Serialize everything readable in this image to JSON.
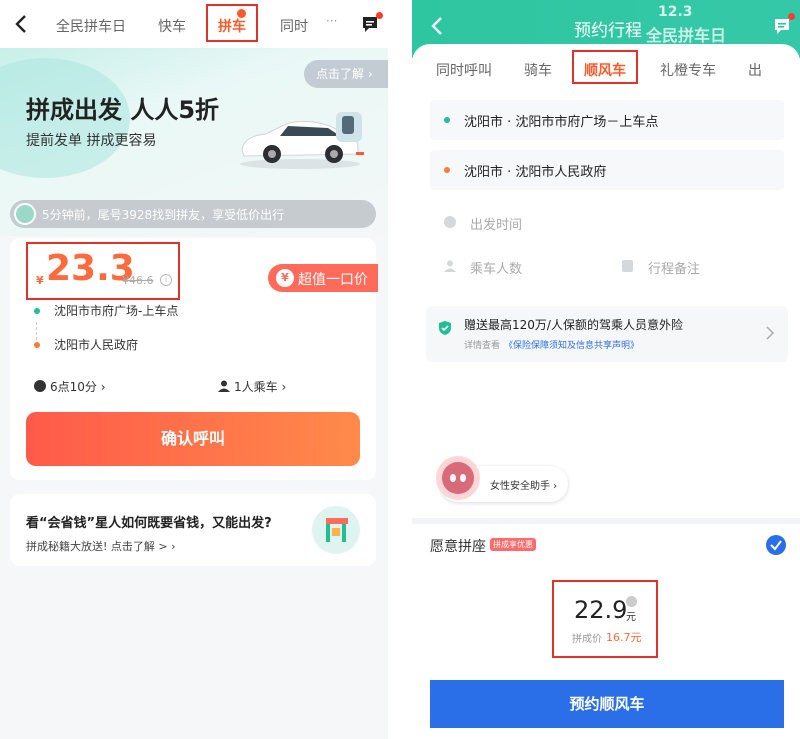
{
  "left": {
    "nav": {
      "tabs": [
        "全民拼车日",
        "快车",
        "拼车",
        "同时"
      ],
      "more": "···"
    },
    "hero": {
      "learn_more": "点击了解 ›",
      "title": "拼成出发 人人5折",
      "subtitle": "提前发单 拼成更容易"
    },
    "notice": "5分钟前，尾号3928找到拼友，享受低价出行",
    "price": {
      "currency": "¥",
      "value": "23.3",
      "original": "¥46.6",
      "badge": "超值一口价",
      "badge_icon": "¥"
    },
    "route": {
      "from": "沈阳市市府广场-上车点",
      "to": "沈阳市人民政府"
    },
    "time": "6点10分 ›",
    "passengers": "1人乘车 ›",
    "confirm": "确认呼叫",
    "promo": {
      "title": "看“会省钱”星人如何既要省钱，又能出发?",
      "sub": "拼成秘籍大放送! 点击了解 > ›"
    }
  },
  "right": {
    "title": "预约行程",
    "event": {
      "date": "12.3",
      "name": "全民拼车日"
    },
    "tabs": [
      "同时呼叫",
      "骑车",
      "顺风车",
      "礼橙专车",
      "出"
    ],
    "from": "沈阳市 · 沈阳市市府广场－上车点",
    "to": "沈阳市 · 沈阳市人民政府",
    "depart_placeholder": "出发时间",
    "passengers_placeholder": "乘车人数",
    "notes_placeholder": "行程备注",
    "insurance": {
      "title": "赠送最高120万/人保额的驾乘人员意外险",
      "detail_prefix": "详情查看",
      "detail_link": "《保险保障须知及信息共享声明》"
    },
    "assistant": "女性安全助手 ›",
    "carpool": {
      "label": "愿意拼座",
      "tag": "拼成享优惠"
    },
    "price": {
      "value": "22.9",
      "unit": "元",
      "pooled_label": "拼成价",
      "pooled_value": "16.7元"
    },
    "book": "预约顺风车"
  },
  "colors": {
    "green": "#1fbf97",
    "orange": "#ff6b3d",
    "red_box": "#e2332b",
    "blue": "#2b6fe8"
  }
}
